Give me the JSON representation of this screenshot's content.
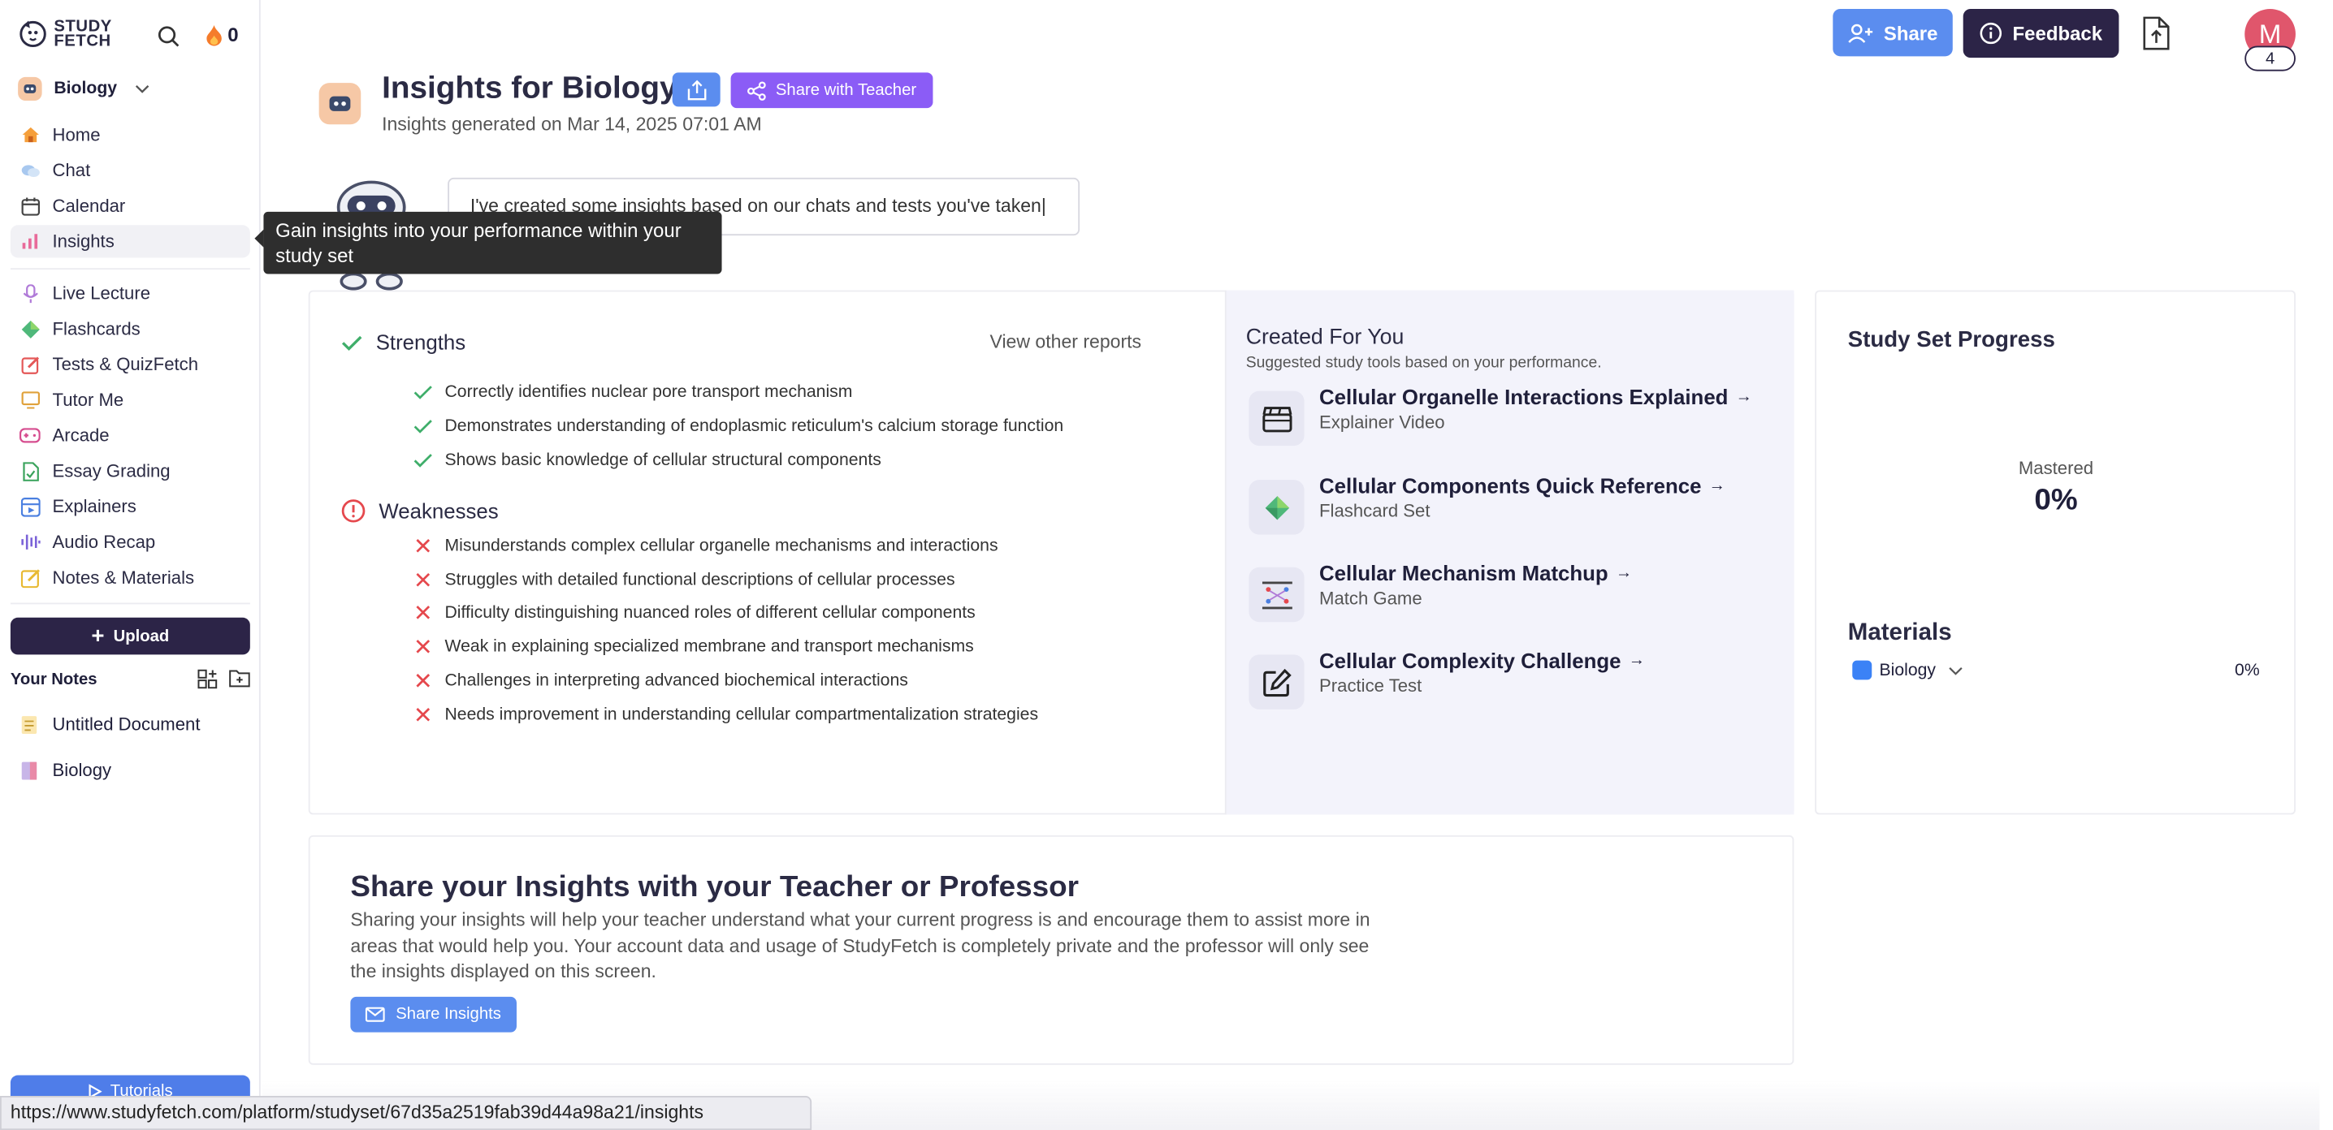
{
  "app": {
    "logo_line1": "STUDY",
    "logo_line2": "FETCH",
    "streak_count": "0"
  },
  "sidebar": {
    "study_set": "Biology",
    "items": [
      {
        "label": "Home",
        "icon": "home-icon"
      },
      {
        "label": "Chat",
        "icon": "chat-icon"
      },
      {
        "label": "Calendar",
        "icon": "calendar-icon"
      },
      {
        "label": "Insights",
        "icon": "bar-chart-icon"
      },
      {
        "label": "Live Lecture",
        "icon": "microphone-icon"
      },
      {
        "label": "Flashcards",
        "icon": "flashcards-icon"
      },
      {
        "label": "Tests & QuizFetch",
        "icon": "test-icon"
      },
      {
        "label": "Tutor Me",
        "icon": "tutor-icon"
      },
      {
        "label": "Arcade",
        "icon": "gamepad-icon"
      },
      {
        "label": "Essay Grading",
        "icon": "essay-icon"
      },
      {
        "label": "Explainers",
        "icon": "explainer-icon"
      },
      {
        "label": "Audio Recap",
        "icon": "audio-wave-icon"
      },
      {
        "label": "Notes & Materials",
        "icon": "notes-icon"
      }
    ],
    "upload_label": "Upload",
    "your_notes": "Your Notes",
    "notes": [
      "Untitled Document",
      "Biology"
    ],
    "tutorials_label": "Tutorials",
    "tooltip": "Gain insights into your performance within your study set"
  },
  "header": {
    "share_label": "Share",
    "feedback_label": "Feedback",
    "avatar_letter": "M",
    "avatar_badge": "4"
  },
  "page": {
    "title": "Insights for Biology",
    "share_teacher_label": "Share with Teacher",
    "generated": "Insights generated on Mar 14, 2025 07:01 AM",
    "bot_message": "I've created some insights based on our chats and tests you've taken|"
  },
  "insights": {
    "strengths_title": "Strengths",
    "view_other": "View other reports",
    "strengths": [
      "Correctly identifies nuclear pore transport mechanism",
      "Demonstrates understanding of endoplasmic reticulum's calcium storage function",
      "Shows basic knowledge of cellular structural components"
    ],
    "weaknesses_title": "Weaknesses",
    "weaknesses": [
      "Misunderstands complex cellular organelle mechanisms and interactions",
      "Struggles with detailed functional descriptions of cellular processes",
      "Difficulty distinguishing nuanced roles of different cellular components",
      "Weak in explaining specialized membrane and transport mechanisms",
      "Challenges in interpreting advanced biochemical interactions",
      "Needs improvement in understanding cellular compartmentalization strategies"
    ]
  },
  "created_for_you": {
    "title": "Created For You",
    "subtitle": "Suggested study tools based on your performance.",
    "tools": [
      {
        "name": "Cellular Organelle Interactions Explained",
        "type": "Explainer Video",
        "icon": "clapperboard-icon"
      },
      {
        "name": "Cellular Components Quick Reference",
        "type": "Flashcard Set",
        "icon": "flashcard-gem-icon"
      },
      {
        "name": "Cellular Mechanism Matchup",
        "type": "Match Game",
        "icon": "match-game-icon"
      },
      {
        "name": "Cellular Complexity Challenge",
        "type": "Practice Test",
        "icon": "edit-icon"
      }
    ]
  },
  "progress": {
    "title": "Study Set Progress",
    "mastered_label": "Mastered",
    "mastered_value": "0%",
    "materials_title": "Materials",
    "material_name": "Biology",
    "material_value": "0%"
  },
  "share_section": {
    "title": "Share your Insights with your Teacher or Professor",
    "text": "Sharing your insights will help your teacher understand what your current progress is and encourage them to assist more in areas that would help you. Your account data and usage of StudyFetch is completely private and the professor will only see the insights displayed on this screen.",
    "button": "Share Insights"
  },
  "status_bar": {
    "url": "https://www.studyfetch.com/platform/studyset/67d35a2519fab39d44a98a21/insights"
  },
  "colors": {
    "primary_blue": "#5b8def",
    "dark_navy": "#2c2447",
    "purple": "#8b5cf6",
    "success_green": "#3fae6a",
    "error_red": "#e5484d",
    "avatar_red": "#e0566c"
  }
}
